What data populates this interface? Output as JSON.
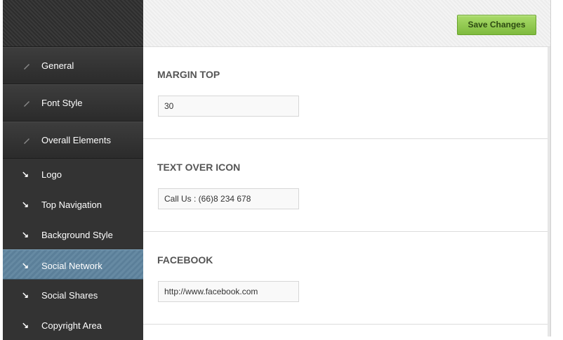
{
  "header": {
    "save_label": "Save Changes"
  },
  "sidebar": {
    "main_items": [
      {
        "label": "General",
        "icon": "pencil-icon"
      },
      {
        "label": "Font Style",
        "icon": "pencil-icon"
      },
      {
        "label": "Overall Elements",
        "icon": "pencil-icon"
      }
    ],
    "sub_items": [
      {
        "label": "Logo",
        "icon": "arrow-down-right-icon"
      },
      {
        "label": "Top Navigation",
        "icon": "arrow-down-right-icon"
      },
      {
        "label": "Background Style",
        "icon": "arrow-down-right-icon"
      },
      {
        "label": "Social Network",
        "icon": "arrow-down-right-icon",
        "active": true
      },
      {
        "label": "Social Shares",
        "icon": "arrow-down-right-icon"
      },
      {
        "label": "Copyright Area",
        "icon": "arrow-down-right-icon"
      }
    ]
  },
  "panels": [
    {
      "title": "MARGIN TOP",
      "value": "30"
    },
    {
      "title": "TEXT OVER ICON",
      "value": "Call Us : (66)8 234 678"
    },
    {
      "title": "FACEBOOK",
      "value": "http://www.facebook.com"
    }
  ],
  "colors": {
    "sidebar_bg": "#333333",
    "active_item": "#5b7f99",
    "save_button": "#8cc84b",
    "heading_text": "#555555"
  }
}
